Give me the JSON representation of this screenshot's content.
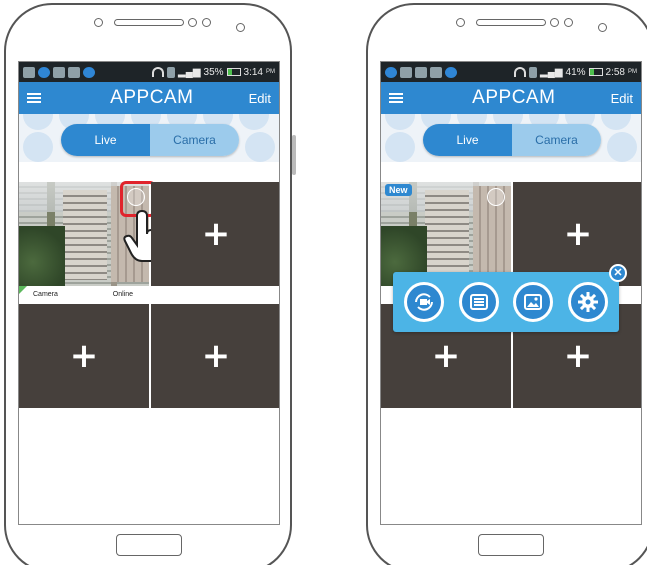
{
  "left_screen": {
    "statusbar": {
      "battery": "35%",
      "time": "3:14",
      "ampm": "PM",
      "battery_level": 0.35
    },
    "appbar": {
      "title": "APPCAM",
      "edit_label": "Edit"
    },
    "toggle": {
      "live_label": "Live",
      "camera_label": "Camera"
    },
    "camera_cell": {
      "name": "Camera",
      "status": "Online"
    },
    "add_cells": [
      "+",
      "+",
      "+"
    ]
  },
  "right_screen": {
    "statusbar": {
      "battery": "41%",
      "time": "2:58",
      "ampm": "PM",
      "battery_level": 0.41
    },
    "appbar": {
      "title": "APPCAM",
      "edit_label": "Edit"
    },
    "toggle": {
      "live_label": "Live",
      "camera_label": "Camera"
    },
    "camera_cell": {
      "badge": "New"
    },
    "add_cells": [
      "+",
      "+",
      "+"
    ],
    "popup": {
      "icons": [
        "replay-icon",
        "list-icon",
        "gallery-icon",
        "settings-icon"
      ],
      "close_label": "✕"
    }
  },
  "colors": {
    "accent": "#2e88d0",
    "toggle_inactive": "#9ccbec",
    "cell_bg": "#46403c",
    "popup_bg": "#4cb4e6",
    "highlight": "#e0242c",
    "online": "#5cb85c"
  }
}
